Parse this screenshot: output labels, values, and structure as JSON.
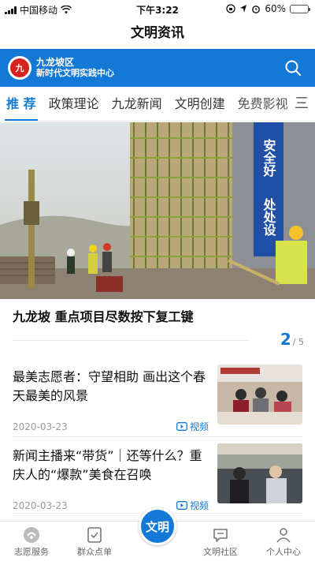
{
  "status_bar": {
    "carrier": "中国移动",
    "time": "下午3:22",
    "battery": "60%",
    "battery_level": 0.6
  },
  "nav": {
    "title": "文明资讯"
  },
  "banner": {
    "logo_text": "九",
    "line1": "九龙坡区",
    "line2": "新时代文明实践中心",
    "search_icon": "search-icon"
  },
  "tabs": [
    {
      "label": "推 荐",
      "active": true
    },
    {
      "label": "政策理论"
    },
    {
      "label": "九龙新闻"
    },
    {
      "label": "文明创建"
    },
    {
      "label": "免费影视"
    }
  ],
  "tabs_more": "三",
  "carousel": {
    "title": "九龙坡 重点项目尽数按下复工键",
    "current": "2",
    "total": "/ 5",
    "banner_text": [
      "安全好",
      "处处设"
    ]
  },
  "news": [
    {
      "title": "最美志愿者：守望相助 画出这个春天最美的风景",
      "date": "2020-03-23",
      "tag": "视频"
    },
    {
      "title": "新闻主播来“带货”｜还等什么？重庆人的“爆款”美食在召唤",
      "date": "2020-03-23",
      "tag": "视频"
    }
  ],
  "tabbar": {
    "items": [
      {
        "label": "志愿服务",
        "icon": "volunteer-icon"
      },
      {
        "label": "群众点单",
        "icon": "order-icon"
      },
      {
        "label": "文明",
        "icon": "civilization-center"
      },
      {
        "label": "文明社区",
        "icon": "chat-icon"
      },
      {
        "label": "个人中心",
        "icon": "person-icon"
      }
    ]
  },
  "colors": {
    "accent": "#1479d6",
    "logo_red": "#d8221f"
  }
}
